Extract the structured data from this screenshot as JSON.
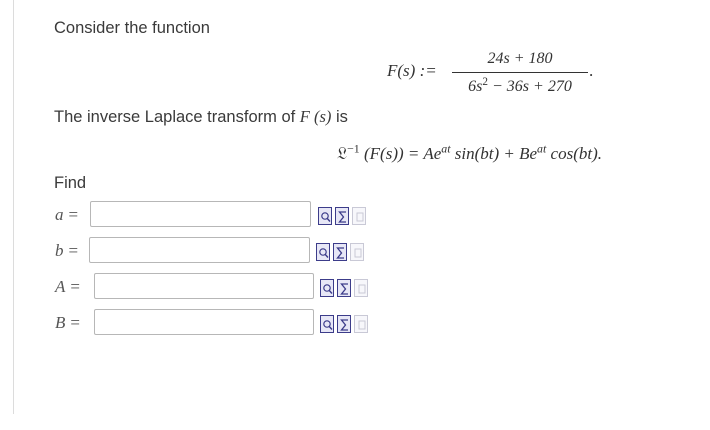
{
  "problem": {
    "intro": "Consider the function",
    "function_def": {
      "lhs": "F(s) :=",
      "numerator": "24s + 180",
      "denominator_lead": "6s",
      "denominator_exp": "2",
      "denominator_rest": " − 36s + 270",
      "end": "."
    },
    "inverse_statement": {
      "prefix": "The inverse Laplace transform of ",
      "func": "F (s)",
      "suffix": " is"
    },
    "inverse_eq": {
      "op": "𝔏",
      "op_exp": "−1",
      "arg": " (F(s)) = ",
      "term1_coef": "Ae",
      "term1_exp": "at",
      "term1_func": " sin(bt) + ",
      "term2_coef": "Be",
      "term2_exp": "at",
      "term2_func": " cos(bt)."
    },
    "find_label": "Find"
  },
  "answers": [
    {
      "var": "a",
      "eq": "=",
      "value": "",
      "tools": [
        "preview-icon",
        "sigma-icon",
        "help-icon"
      ]
    },
    {
      "var": "b",
      "eq": "=",
      "value": "",
      "tools": [
        "preview-icon",
        "sigma-icon",
        "help-icon"
      ]
    },
    {
      "var": "A",
      "eq": "=",
      "value": "",
      "tools": [
        "preview-icon",
        "sigma-icon",
        "help-icon"
      ]
    },
    {
      "var": "B",
      "eq": "=",
      "value": "",
      "tools": [
        "preview-icon",
        "sigma-icon",
        "help-icon"
      ]
    }
  ],
  "colors": {
    "icon_border": "#3c3c8a",
    "icon_fill": "#e7e7f6",
    "input_border": "#b7b7b7",
    "frame_line": "#dcdcdc"
  }
}
